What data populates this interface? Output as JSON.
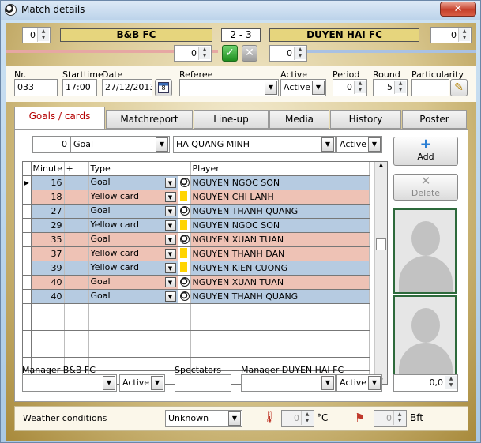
{
  "window": {
    "title": "Match details",
    "close": "✕"
  },
  "score": {
    "home_id": "0",
    "away_id": "0",
    "home_team": "B&B FC",
    "away_team": "DUYEN HAI FC",
    "result": "2  - 3",
    "home_sub": "0",
    "away_sub": "0"
  },
  "colors": {
    "home_stripe": "#e6a7a3",
    "away_stripe": "#a9c1e3",
    "accent_tab": "#b40000"
  },
  "info": {
    "nr_label": "Nr.",
    "nr": "033",
    "starttime_label": "Starttime",
    "starttime": "17:00",
    "date_label": "Date",
    "date": "27/12/2013",
    "referee_label": "Referee",
    "referee": "",
    "active_label": "Active",
    "active": "Active",
    "period_label": "Period",
    "period": "0",
    "round_label": "Round",
    "round": "5",
    "particularity_label": "Particularity",
    "particularity": ""
  },
  "tabs": [
    "Goals / cards",
    "Matchreport",
    "Line-up",
    "Media",
    "History",
    "Poster"
  ],
  "filter": {
    "minute": "0",
    "type": "Goal",
    "player": "HA QUANG MINH",
    "status": "Active"
  },
  "grid": {
    "columns": [
      "Minute",
      "+",
      "Type",
      "",
      "Player"
    ],
    "rows": [
      {
        "minute": "16",
        "type": "Goal",
        "icon": "ball",
        "player": "NGUYEN NGOC SON",
        "team": "blue"
      },
      {
        "minute": "18",
        "type": "Yellow card",
        "icon": "card",
        "player": "NGUYEN CHI LANH",
        "team": "pink"
      },
      {
        "minute": "27",
        "type": "Goal",
        "icon": "ball",
        "player": "NGUYEN THANH QUANG",
        "team": "blue"
      },
      {
        "minute": "29",
        "type": "Yellow card",
        "icon": "card",
        "player": "NGUYEN NGOC SON",
        "team": "blue"
      },
      {
        "minute": "35",
        "type": "Goal",
        "icon": "ball",
        "player": "NGUYEN XUAN TUAN",
        "team": "pink"
      },
      {
        "minute": "37",
        "type": "Yellow card",
        "icon": "card",
        "player": "NGUYEN THANH DAN",
        "team": "pink"
      },
      {
        "minute": "39",
        "type": "Yellow card",
        "icon": "card",
        "player": "NGUYEN KIEN CUONG",
        "team": "blue"
      },
      {
        "minute": "40",
        "type": "Goal",
        "icon": "ball",
        "player": "NGUYEN XUAN TUAN",
        "team": "pink"
      },
      {
        "minute": "40",
        "type": "Goal",
        "icon": "ball",
        "player": "NGUYEN THANH QUANG",
        "team": "blue"
      }
    ],
    "empty_rows": 6
  },
  "buttons": {
    "add": "Add",
    "delete": "Delete"
  },
  "bottom": {
    "manager_home_label": "Manager B&B FC",
    "manager_home": "",
    "manager_home_status": "Active",
    "spectators_label": "Spectators",
    "spectators": "",
    "manager_away_label": "Manager DUYEN HAI FC",
    "manager_away": "",
    "manager_away_status": "Active",
    "rating": "0,0"
  },
  "weather": {
    "label": "Weather conditions",
    "condition": "Unknown",
    "temp": "0",
    "temp_unit": "°C",
    "wind": "0",
    "wind_unit": "Bft"
  }
}
